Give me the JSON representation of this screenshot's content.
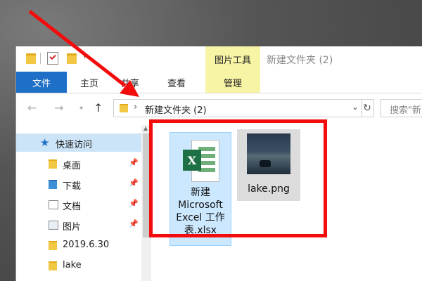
{
  "window": {
    "title": "新建文件夹 (2)",
    "context_tab_label": "图片工具"
  },
  "ribbon": {
    "tabs": [
      {
        "label": "文件"
      },
      {
        "label": "主页"
      },
      {
        "label": "共享"
      },
      {
        "label": "查看"
      },
      {
        "label": "管理"
      }
    ]
  },
  "navigation": {
    "address": "新建文件夹 (2)",
    "search_placeholder": "搜索\"新"
  },
  "sidebar": {
    "items": [
      {
        "label": "快速访问",
        "icon": "star-icon",
        "pinned": false
      },
      {
        "label": "桌面",
        "icon": "folder-icon",
        "pinned": true
      },
      {
        "label": "下载",
        "icon": "download-folder-icon",
        "pinned": true
      },
      {
        "label": "文档",
        "icon": "document-icon",
        "pinned": true
      },
      {
        "label": "图片",
        "icon": "pictures-icon",
        "pinned": true
      },
      {
        "label": "2019.6.30",
        "icon": "folder-icon",
        "pinned": false
      },
      {
        "label": "lake",
        "icon": "folder-icon",
        "pinned": false
      }
    ]
  },
  "files": [
    {
      "name": "新建\nMicrosoft\nExcel 工作\n表.xlsx",
      "type": "excel",
      "selected": true
    },
    {
      "name": "lake.png",
      "type": "image",
      "selected": false
    }
  ],
  "colors": {
    "accent": "#1e6fc7",
    "context_tab": "#f8f4a6",
    "annotation": "#f20c0c",
    "selection": "#cce8ff"
  }
}
